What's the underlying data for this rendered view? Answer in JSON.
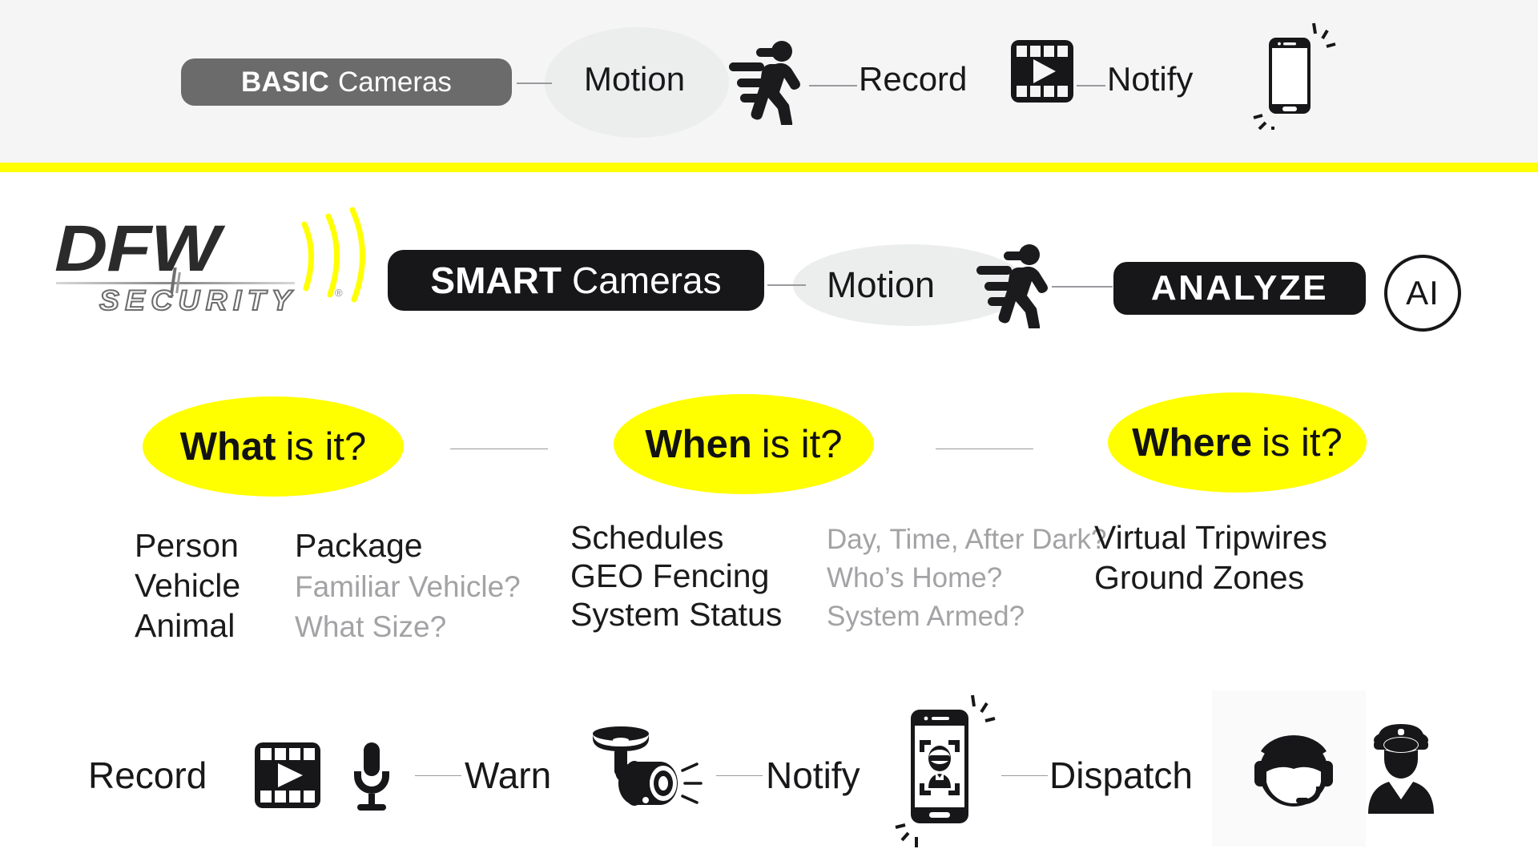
{
  "brand": {
    "logo_main": "DFW",
    "logo_sub": "SECURITY",
    "registered_mark": "®",
    "accent_yellow": "#ffff00",
    "dark": "#17171a",
    "gray_pill": "#6b6b6b",
    "muted_text": "#a3a3a6"
  },
  "basic_row": {
    "badge_bold": "BASIC",
    "badge_light": "Cameras",
    "steps": [
      {
        "label": "Motion",
        "icon": "walking-person-motion-icon"
      },
      {
        "label": "Record",
        "icon": "film-play-icon"
      },
      {
        "label": "Notify",
        "icon": "vibrating-phone-icon"
      }
    ]
  },
  "smart_row": {
    "badge_bold": "SMART",
    "badge_light": "Cameras",
    "motion_label": "Motion",
    "analyze_label": "ANALYZE",
    "ai_label": "AI"
  },
  "questions": [
    {
      "strong": "What",
      "light": "is it?"
    },
    {
      "strong": "When",
      "light": "is it?"
    },
    {
      "strong": "Where",
      "light": "is it?"
    }
  ],
  "what_column": {
    "rows": [
      {
        "primary": "Person",
        "secondary": "Package",
        "secondary_muted": false
      },
      {
        "primary": "Vehicle",
        "secondary": "Familiar Vehicle?",
        "secondary_muted": true
      },
      {
        "primary": "Animal",
        "secondary": "What Size?",
        "secondary_muted": true
      }
    ]
  },
  "when_column": {
    "rows": [
      {
        "primary": "Schedules",
        "secondary": "Day, Time, After Dark?"
      },
      {
        "primary": "GEO Fencing",
        "secondary": "Who’s Home?"
      },
      {
        "primary": "System Status",
        "secondary": "System Armed?"
      }
    ]
  },
  "where_column": {
    "rows": [
      {
        "primary": "Virtual Tripwires"
      },
      {
        "primary": "Ground Zones"
      }
    ]
  },
  "action_row": {
    "steps": [
      {
        "label": "Record",
        "icons": [
          "film-play-icon",
          "microphone-icon"
        ]
      },
      {
        "label": "Warn",
        "icons": [
          "ceiling-bullet-camera-icon"
        ]
      },
      {
        "label": "Notify",
        "icons": [
          "phone-face-detect-icon"
        ]
      },
      {
        "label": "Dispatch",
        "icons": [
          "headset-operator-icon",
          "police-officer-icon"
        ]
      }
    ]
  }
}
